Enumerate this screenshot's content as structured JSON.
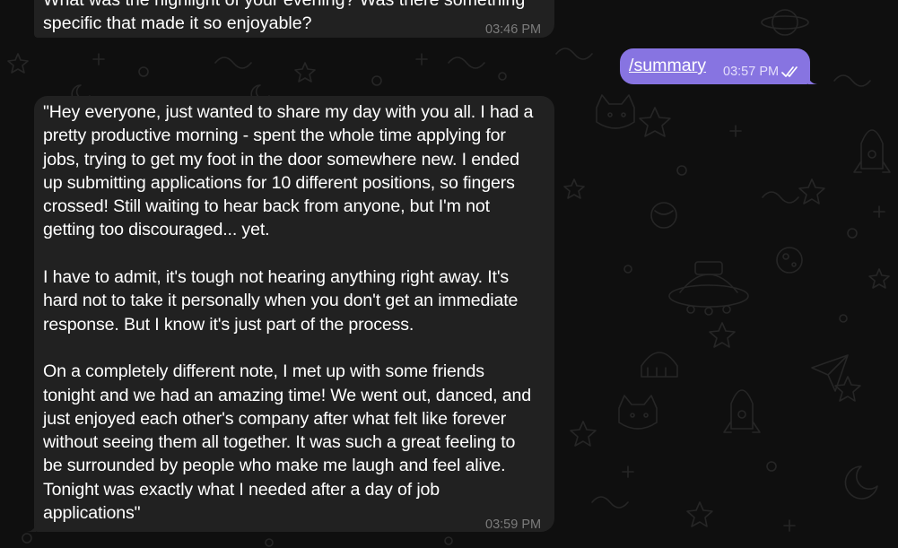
{
  "colors": {
    "background": "#0f0f0f",
    "incoming_bubble": "#212121",
    "outgoing_bubble": "#8774e1",
    "time_text": "#7c7c7c",
    "outgoing_time_text": "#e4defb"
  },
  "messages": [
    {
      "direction": "incoming",
      "text": "What was the highlight of your evening? Was there something\nspecific that made it so enjoyable?",
      "time": "03:46 PM"
    },
    {
      "direction": "outgoing",
      "text": "/summary",
      "time": "03:57 PM",
      "status_icon": "double-check-icon"
    },
    {
      "direction": "incoming",
      "text": "\"Hey everyone, just wanted to share my day with you all. I had a\npretty productive morning - spent the whole time applying for\njobs, trying to get my foot in the door somewhere new. I ended\nup submitting applications for 10 different positions, so fingers\ncrossed! Still waiting to hear back from anyone, but I'm not\ngetting too discouraged... yet.\n\nI have to admit, it's tough not hearing anything right away. It's\nhard not to take it personally when you don't get an immediate\nresponse. But I know it's just part of the process.\n\nOn a completely different note, I met up with some friends\ntonight and we had an amazing time! We went out, danced, and\njust enjoyed each other's company after what felt like forever\nwithout seeing them all together. It was such a great feeling to\nbe surrounded by people who make me laugh and feel alive.\nTonight was exactly what I needed after a day of job\napplications\"",
      "time": "03:59 PM"
    }
  ]
}
